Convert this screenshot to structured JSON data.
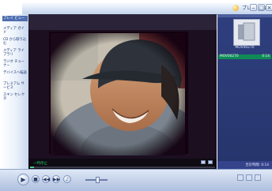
{
  "window": {
    "title": "プレイ ビュー",
    "minimize": "–",
    "maximize": "□",
    "close": "×"
  },
  "sidebar": {
    "items": [
      {
        "label": "プレイ ビュー"
      },
      {
        "label": "メディア ガイド"
      },
      {
        "label": "CD から取り込む"
      },
      {
        "label": "メディア ライブラリ"
      },
      {
        "label": "ラジオ チューナー"
      },
      {
        "label": "デバイスへ転送"
      },
      {
        "label": "プレミアム サービス"
      },
      {
        "label": "スキン セレクタ"
      }
    ]
  },
  "now_playing": {
    "album_caption": "MOV00270",
    "track_time": "MOV00270",
    "track_duration": "0:14",
    "total": "合計時間: 0:14"
  },
  "status": {
    "text": "一時停止",
    "progress": 0.02
  },
  "controls": {
    "play_icon": "play-icon",
    "play_glyph": "▶",
    "stop_glyph": "■",
    "prev_glyph": "◀◀",
    "next_glyph": "▶▶",
    "mute_glyph": "♪",
    "volume": 0.5
  },
  "colors": {
    "accent": "#2e4aa0",
    "status_text": "#23c36a",
    "track_row": "#0f8a57",
    "video_bg": "#1b0f20"
  }
}
